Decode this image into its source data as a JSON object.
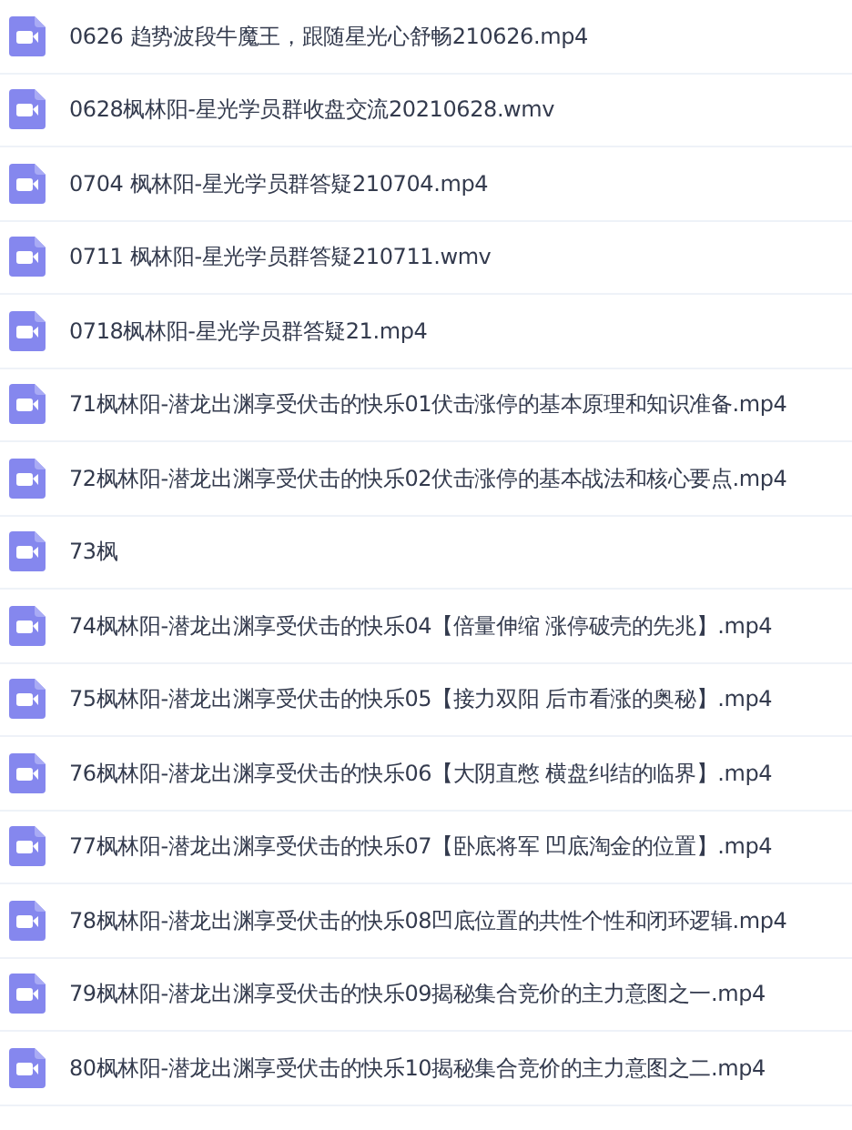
{
  "files": [
    {
      "name": "0626 趋势波段牛魔王，跟随星光心舒畅210626.mp4"
    },
    {
      "name": "0628枫林阳-星光学员群收盘交流20210628.wmv"
    },
    {
      "name": "0704 枫林阳-星光学员群答疑210704.mp4"
    },
    {
      "name": "0711 枫林阳-星光学员群答疑210711.wmv"
    },
    {
      "name": "0718枫林阳-星光学员群答疑21.mp4"
    },
    {
      "name": "71枫林阳-潜龙出渊享受伏击的快乐01伏击涨停的基本原理和知识准备.mp4"
    },
    {
      "name": "72枫林阳-潜龙出渊享受伏击的快乐02伏击涨停的基本战法和核心要点.mp4"
    },
    {
      "name": "73枫"
    },
    {
      "name": "74枫林阳-潜龙出渊享受伏击的快乐04【倍量伸缩 涨停破壳的先兆】.mp4"
    },
    {
      "name": "75枫林阳-潜龙出渊享受伏击的快乐05【接力双阳 后市看涨的奥秘】.mp4"
    },
    {
      "name": "76枫林阳-潜龙出渊享受伏击的快乐06【大阴直憋 横盘纠结的临界】.mp4"
    },
    {
      "name": "77枫林阳-潜龙出渊享受伏击的快乐07【卧底将军 凹底淘金的位置】.mp4"
    },
    {
      "name": "78枫林阳-潜龙出渊享受伏击的快乐08凹底位置的共性个性和闭环逻辑.mp4"
    },
    {
      "name": "79枫林阳-潜龙出渊享受伏击的快乐09揭秘集合竞价的主力意图之一.mp4"
    },
    {
      "name": "80枫林阳-潜龙出渊享受伏击的快乐10揭秘集合竞价的主力意图之二.mp4"
    }
  ]
}
